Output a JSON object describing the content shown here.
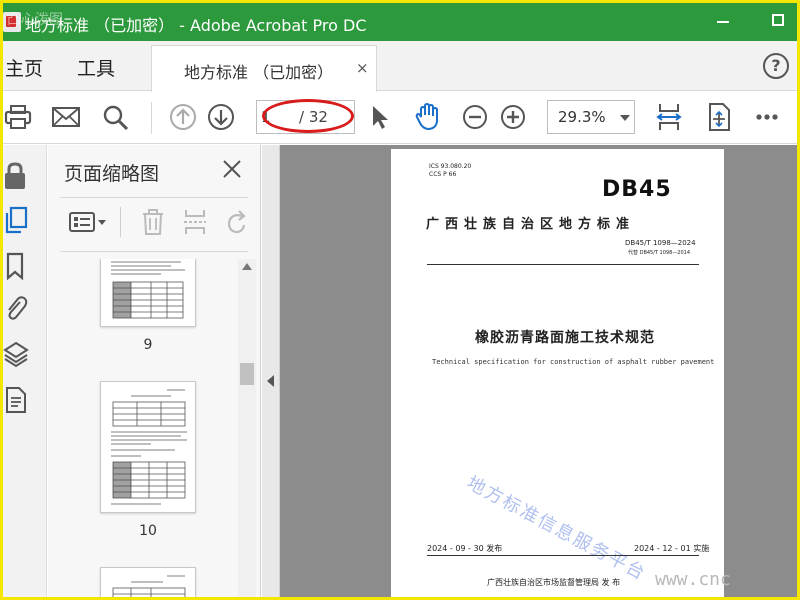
{
  "window": {
    "title": "地方标准 （已加密） - Adobe Acrobat Pro DC",
    "corner_watermark": "凸心泼图",
    "accent_color": "#2c9a3c",
    "frame_color": "#f5e600"
  },
  "menu": {
    "home": "主页",
    "tools": "工具",
    "tab_label": "地方标准 （已加密）",
    "tab_close": "×",
    "help": "?"
  },
  "toolbar": {
    "icons": [
      "print-icon",
      "email-icon",
      "search-icon",
      "prev-page-icon",
      "next-page-icon",
      "select-cursor-icon",
      "hand-icon",
      "zoom-out-icon",
      "zoom-in-icon",
      "fit-page-icon",
      "scan-icon",
      "more-icon"
    ],
    "current_page": "1",
    "total_pages": "/ 32",
    "zoom": "29.3%"
  },
  "rail": {
    "icons": [
      "lock-icon",
      "pages-icon",
      "bookmark-icon",
      "attachment-icon",
      "layers-icon",
      "document-icon"
    ]
  },
  "thumbnails": {
    "title": "页面缩略图",
    "pages": [
      {
        "number": "9"
      },
      {
        "number": "10"
      },
      {
        "number": ""
      }
    ]
  },
  "document": {
    "ics": "ICS 93.080.20",
    "ccs": "CCS P 66",
    "code": "DB45",
    "region": "广西壮族自治区地方标准",
    "standard_no": "DB45/T 1098—2024",
    "replaces": "代替 DB45/T 1098—2014",
    "title": "橡胶沥青路面施工技术规范",
    "subtitle": "Technical specification for construction of asphalt rubber pavement",
    "watermark": "地方标准信息服务平台",
    "publish_date": "2024 - 09 - 30 发布",
    "implement_date": "2024 - 12 - 01 实施",
    "issuer": "广西壮族自治区市场监督管理局    发 布"
  },
  "site_watermark": "www.cnc"
}
